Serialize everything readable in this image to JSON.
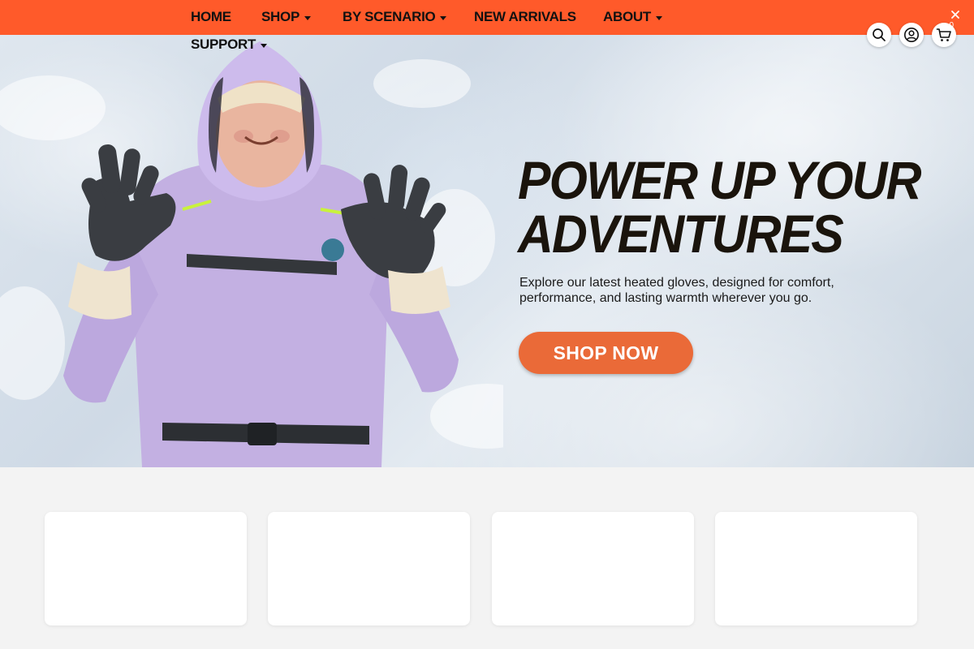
{
  "nav": {
    "items": [
      {
        "label": "HOME",
        "has_dropdown": false
      },
      {
        "label": "SHOP",
        "has_dropdown": true
      },
      {
        "label": "BY SCENARIO",
        "has_dropdown": true
      },
      {
        "label": "NEW ARRIVALS",
        "has_dropdown": false
      },
      {
        "label": "ABOUT",
        "has_dropdown": true
      },
      {
        "label": "SUPPORT",
        "has_dropdown": true
      }
    ]
  },
  "header": {
    "icons": [
      "search-icon",
      "account-icon",
      "cart-icon"
    ],
    "cart_count": "0",
    "close_icon": "close-icon"
  },
  "hero": {
    "title_line1": "POWER UP YOUR",
    "title_line2": "ADVENTURES",
    "subtitle": "Explore our latest heated gloves, designed for comfort, performance, and lasting warmth wherever you go.",
    "cta_label": "SHOP NOW"
  },
  "colors": {
    "topbar": "#ff5a2a",
    "cta": "#ea6a38",
    "page_background": "#f3f3f3",
    "card": "#ffffff"
  }
}
